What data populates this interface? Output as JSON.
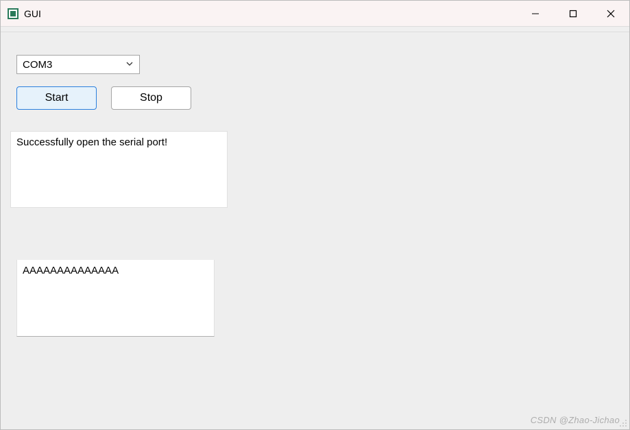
{
  "window": {
    "title": "GUI"
  },
  "controls": {
    "port_selected": "COM3",
    "start_label": "Start",
    "stop_label": "Stop"
  },
  "log": {
    "text": "Successfully open the serial port!"
  },
  "input": {
    "text": "AAAAAAAAAAAAAA"
  },
  "watermark": "CSDN @Zhao-Jichao"
}
